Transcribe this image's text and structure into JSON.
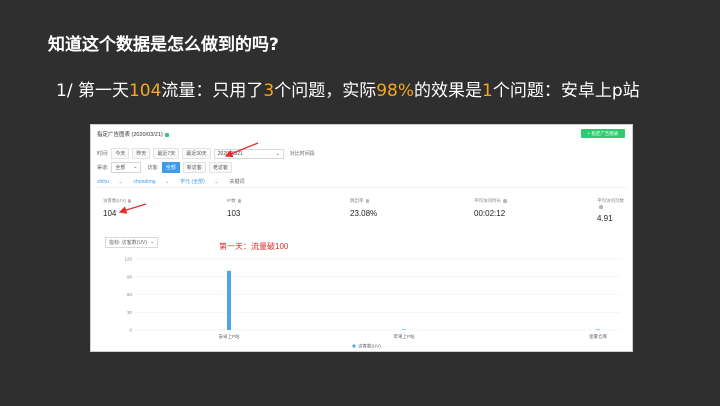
{
  "slide": {
    "title": "知道这个数据是怎么做到的吗?",
    "subtitle_parts": [
      "1/  第一天",
      "104",
      "流量：只用了",
      "3",
      "个问题，实际",
      "98%",
      "的效果是",
      "1",
      "个问题：安卓上p站"
    ],
    "highlight_color": "#f5a623"
  },
  "panel": {
    "title": "指定广告图表 (2020/03/21)",
    "add_button": "+ 指定广告图表",
    "time_filter": {
      "label": "时间:",
      "options": [
        "今天",
        "昨天",
        "最近7天",
        "最近30天"
      ],
      "date_value": "2020/03/21",
      "compare_label": "对比时间段"
    },
    "channel_filter": {
      "label": "渠道:",
      "selected": "全部",
      "visitor_label": "访客:",
      "visitor_options": [
        "全部",
        "新访客",
        "老访客"
      ],
      "active_index": 0
    },
    "tags": [
      "zhihu",
      "chendong",
      "学元 (全部)",
      "关键词"
    ],
    "metrics": [
      {
        "label": "访客数(UV)",
        "value": "104"
      },
      {
        "label": "IP数",
        "value": "103"
      },
      {
        "label": "跳出率",
        "value": "23.08%"
      },
      {
        "label": "平均访问时长",
        "value": "00:02:12"
      },
      {
        "label": "平均访问页数",
        "value": "4.91"
      }
    ],
    "chart_filter": "指标: 访客数(UV)",
    "annotation": "第一天：流量破100",
    "accent_color": "#3d9be9",
    "arrow_color": "#e02d2d"
  },
  "chart_data": {
    "type": "bar",
    "categories": [
      "安卓上P站",
      "苹果上P站",
      "迷雾仓库"
    ],
    "values": [
      100,
      1,
      1
    ],
    "ylim": [
      0,
      120
    ],
    "yticks": [
      0,
      30,
      60,
      90,
      120
    ],
    "legend": "访客数(UV)",
    "legend_position": "bottom",
    "color": "#4ea6ea"
  }
}
